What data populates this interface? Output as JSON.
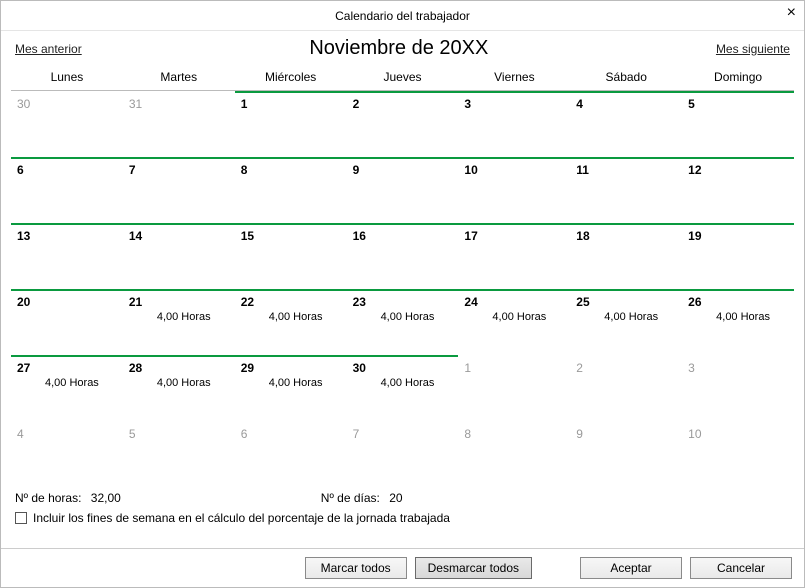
{
  "window": {
    "title": "Calendario del trabajador",
    "close_label": "×"
  },
  "nav": {
    "prev": "Mes anterior",
    "month": "Noviembre de 20XX",
    "next": "Mes siguiente"
  },
  "weekdays": [
    "Lunes",
    "Martes",
    "Miércoles",
    "Jueves",
    "Viernes",
    "Sábado",
    "Domingo"
  ],
  "grid": [
    [
      {
        "n": "30",
        "in": false,
        "hours": ""
      },
      {
        "n": "31",
        "in": false,
        "hours": ""
      },
      {
        "n": "1",
        "in": true,
        "hours": ""
      },
      {
        "n": "2",
        "in": true,
        "hours": ""
      },
      {
        "n": "3",
        "in": true,
        "hours": ""
      },
      {
        "n": "4",
        "in": true,
        "hours": ""
      },
      {
        "n": "5",
        "in": true,
        "hours": ""
      }
    ],
    [
      {
        "n": "6",
        "in": true,
        "hours": ""
      },
      {
        "n": "7",
        "in": true,
        "hours": ""
      },
      {
        "n": "8",
        "in": true,
        "hours": ""
      },
      {
        "n": "9",
        "in": true,
        "hours": ""
      },
      {
        "n": "10",
        "in": true,
        "hours": ""
      },
      {
        "n": "11",
        "in": true,
        "hours": ""
      },
      {
        "n": "12",
        "in": true,
        "hours": ""
      }
    ],
    [
      {
        "n": "13",
        "in": true,
        "hours": ""
      },
      {
        "n": "14",
        "in": true,
        "hours": ""
      },
      {
        "n": "15",
        "in": true,
        "hours": ""
      },
      {
        "n": "16",
        "in": true,
        "hours": ""
      },
      {
        "n": "17",
        "in": true,
        "hours": ""
      },
      {
        "n": "18",
        "in": true,
        "hours": ""
      },
      {
        "n": "19",
        "in": true,
        "hours": ""
      }
    ],
    [
      {
        "n": "20",
        "in": true,
        "hours": ""
      },
      {
        "n": "21",
        "in": true,
        "hours": "4,00 Horas"
      },
      {
        "n": "22",
        "in": true,
        "hours": "4,00 Horas"
      },
      {
        "n": "23",
        "in": true,
        "hours": "4,00 Horas"
      },
      {
        "n": "24",
        "in": true,
        "hours": "4,00 Horas"
      },
      {
        "n": "25",
        "in": true,
        "hours": "4,00 Horas"
      },
      {
        "n": "26",
        "in": true,
        "hours": "4,00 Horas"
      }
    ],
    [
      {
        "n": "27",
        "in": true,
        "hours": "4,00 Horas"
      },
      {
        "n": "28",
        "in": true,
        "hours": "4,00 Horas"
      },
      {
        "n": "29",
        "in": true,
        "hours": "4,00 Horas"
      },
      {
        "n": "30",
        "in": true,
        "hours": "4,00 Horas"
      },
      {
        "n": "1",
        "in": false,
        "hours": ""
      },
      {
        "n": "2",
        "in": false,
        "hours": ""
      },
      {
        "n": "3",
        "in": false,
        "hours": ""
      }
    ],
    [
      {
        "n": "4",
        "in": false,
        "hours": ""
      },
      {
        "n": "5",
        "in": false,
        "hours": ""
      },
      {
        "n": "6",
        "in": false,
        "hours": ""
      },
      {
        "n": "7",
        "in": false,
        "hours": ""
      },
      {
        "n": "8",
        "in": false,
        "hours": ""
      },
      {
        "n": "9",
        "in": false,
        "hours": ""
      },
      {
        "n": "10",
        "in": false,
        "hours": ""
      }
    ]
  ],
  "summary": {
    "hours_label": "Nº de horas:",
    "hours_value": "32,00",
    "days_label": "Nº de días:",
    "days_value": "20"
  },
  "options": {
    "include_weekends_label": "Incluir los fines de semana en el cálculo del porcentaje de la jornada trabajada",
    "include_weekends_checked": false
  },
  "buttons": {
    "mark_all": "Marcar todos",
    "unmark_all": "Desmarcar todos",
    "accept": "Aceptar",
    "cancel": "Cancelar"
  }
}
